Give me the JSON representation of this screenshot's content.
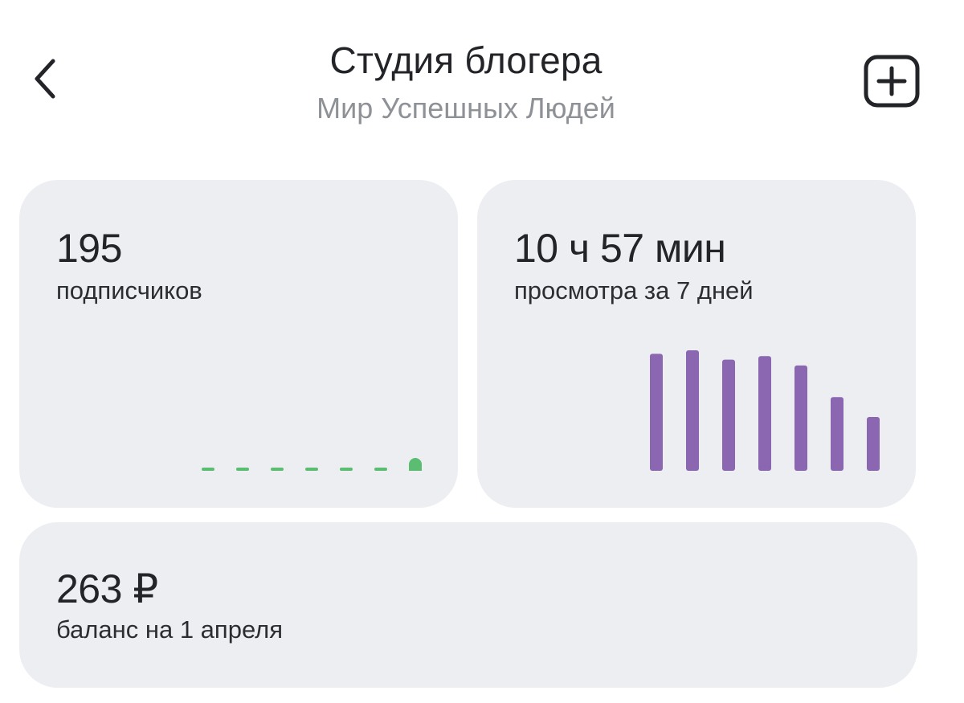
{
  "header": {
    "title": "Студия блогера",
    "subtitle": "Мир Успешных Людей",
    "back_icon": "chevron-left-icon",
    "add_icon": "plus-square-icon"
  },
  "subscribers": {
    "value": "195",
    "label": "подписчиков"
  },
  "views": {
    "value": "10 ч 57 мин",
    "label": "просмотра за 7 дней"
  },
  "balance": {
    "value": "263 ₽",
    "label": "баланс на 1 апреля"
  },
  "colors": {
    "card_bg": "#eceef1",
    "subscribers_accent": "#5bbd72",
    "views_accent": "#8a67b0",
    "subtitle_text": "#8e9196"
  },
  "chart_data": [
    {
      "type": "bar",
      "series": [
        {
          "values": [
            0,
            0,
            0,
            0,
            0,
            0,
            1
          ]
        }
      ],
      "categories": [],
      "ylim": [
        0,
        1
      ]
    },
    {
      "type": "bar",
      "series": [
        {
          "values": [
            100,
            103,
            95,
            98,
            90,
            63,
            46
          ]
        }
      ],
      "categories": [],
      "ylim": [
        0,
        103
      ]
    }
  ]
}
